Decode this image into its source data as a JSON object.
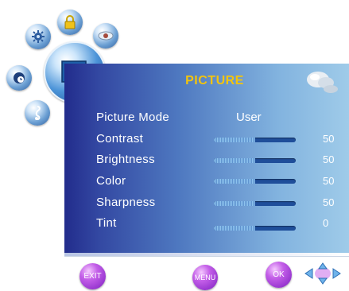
{
  "menu": {
    "title": "PICTURE",
    "items": [
      {
        "label": "Picture Mode",
        "value": "User"
      },
      {
        "label": "Contrast",
        "value": "50",
        "level": 0.5
      },
      {
        "label": "Brightness",
        "value": "50",
        "level": 0.5
      },
      {
        "label": "Color",
        "value": "50",
        "level": 0.5
      },
      {
        "label": "Sharpness",
        "value": "50",
        "level": 0.5
      },
      {
        "label": "Tint",
        "value": "0",
        "level": 0.5
      }
    ]
  },
  "footer": {
    "exit_label": "EXIT",
    "menu_label": "MENU",
    "ok_label": "OK"
  },
  "icons": {
    "top": "lock-icon",
    "left_top": "gear-icon",
    "right_top": "eye-icon",
    "left": "clock-icon",
    "bottom": "music-note-icon",
    "center": "picture-icon",
    "corner": "clouds-icon",
    "navigation": "arrow-pad-icon"
  },
  "colors": {
    "title": "#f2c40e",
    "panel_dark": "#222c8c",
    "panel_light": "#9fcbe9",
    "button": "#c35ee8"
  }
}
